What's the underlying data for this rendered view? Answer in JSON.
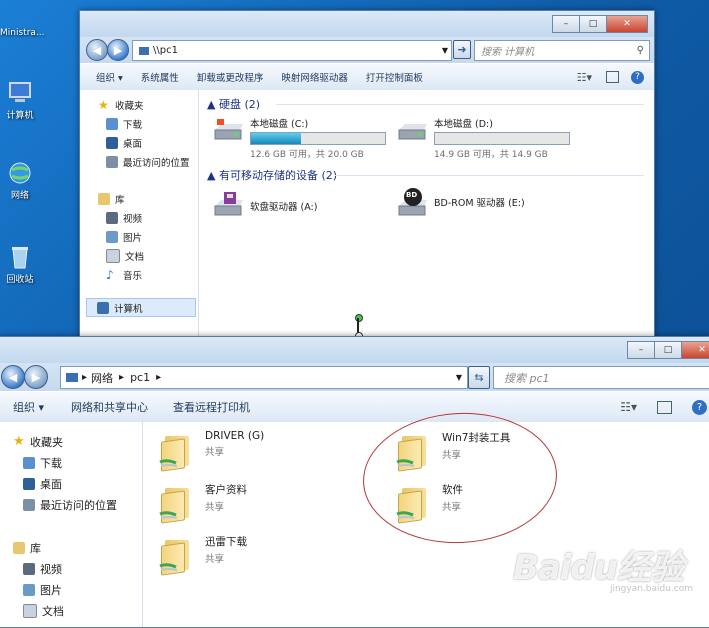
{
  "desktop": {
    "icons": [
      {
        "label": "Ministra...",
        "icon": "user-folder-icon"
      },
      {
        "label": "计算机",
        "icon": "computer-icon"
      },
      {
        "label": "网络",
        "icon": "network-globe-icon"
      },
      {
        "label": "回收站",
        "icon": "recycle-bin-icon"
      }
    ]
  },
  "top_window": {
    "address": "\\\\pc1",
    "search_placeholder": "搜索 计算机",
    "toolbar": [
      "组织 ▾",
      "系统属性",
      "卸载或更改程序",
      "映射网络驱动器",
      "打开控制面板"
    ],
    "nav": {
      "favorites": "收藏夹",
      "fav_items": [
        "下载",
        "桌面",
        "最近访问的位置"
      ],
      "library": "库",
      "lib_items": [
        "视频",
        "图片",
        "文档",
        "音乐"
      ],
      "computer": "计算机"
    },
    "groups": {
      "hdd": "硬盘 (2)",
      "removable": "有可移动存储的设备 (2)"
    },
    "drives": [
      {
        "name": "本地磁盘 (C:)",
        "free": "12.6 GB 可用，共 20.0 GB",
        "used_fraction": 0.37
      },
      {
        "name": "本地磁盘 (D:)",
        "free": "14.9 GB 可用，共 14.9 GB",
        "used_fraction": 0.0
      }
    ],
    "devices": [
      {
        "name": "软盘驱动器 (A:)"
      },
      {
        "name": "BD-ROM 驱动器 (E:)",
        "badge": "BD"
      }
    ]
  },
  "bottom_window": {
    "breadcrumb": [
      "网络",
      "pc1"
    ],
    "search_placeholder": "搜索 pc1",
    "toolbar": [
      "组织 ▾",
      "网络和共享中心",
      "查看远程打印机"
    ],
    "nav": {
      "favorites": "收藏夹",
      "fav_items": [
        "下载",
        "桌面",
        "最近访问的位置"
      ],
      "library": "库",
      "lib_items": [
        "视频",
        "图片",
        "文档"
      ]
    },
    "folders": [
      {
        "name": "DRIVER (G)",
        "sub": "共享"
      },
      {
        "name": "客户资料",
        "sub": "共享"
      },
      {
        "name": "迅雷下载",
        "sub": "共享"
      },
      {
        "name": "Win7封装工具",
        "sub": "共享"
      },
      {
        "name": "软件",
        "sub": "共享"
      }
    ]
  },
  "watermark": {
    "brand": "Baidu经验",
    "url": "jingyan.baidu.com"
  }
}
